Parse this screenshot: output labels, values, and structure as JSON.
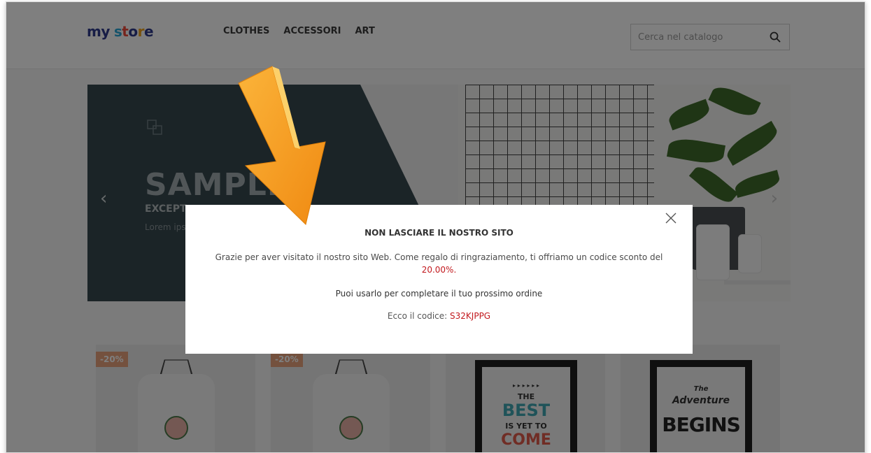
{
  "header": {
    "logo": {
      "letters": [
        "m",
        "y",
        " ",
        "s",
        "t",
        "o",
        "r",
        "e"
      ],
      "colors": [
        "#2e3a8c",
        "#2e3a8c",
        "#2e3a8c",
        "#2aa7d6",
        "#ef4a3a",
        "#2e3a8c",
        "#f2a51a",
        "#2e3a8c"
      ]
    },
    "nav": [
      "CLOTHES",
      "ACCESSORI",
      "ART"
    ],
    "search": {
      "placeholder": "Cerca nel catalogo",
      "icon": "search-icon"
    }
  },
  "carousel": {
    "title": "SAMPLE",
    "subtitle": "EXCEPT",
    "text": "Lorem ips adipiscin dignissim egestas s",
    "prev_icon": "chevron-left-icon",
    "next_icon": "chevron-right-icon"
  },
  "products": [
    {
      "badge": "-20%"
    },
    {
      "badge": "-20%"
    },
    {
      "poster_lines": [
        "▸ ▸ ▸ ▸ ▸ ▸",
        "THE",
        "BEST",
        "IS YET TO",
        "COME"
      ]
    },
    {
      "poster_lines": [
        "The",
        "Adventure",
        "BEGINS"
      ]
    }
  ],
  "modal": {
    "title": "NON LASCIARE IL NOSTRO SITO",
    "paragraph1_text": "Grazie per aver visitato il nostro sito Web. Come regalo di ringraziamento, ti offriamo un codice sconto del ",
    "paragraph1_highlight": "20.00%.",
    "paragraph2": "Puoi usarlo per completare il tuo prossimo ordine",
    "code_label": "Ecco il codice: ",
    "code": "S32KJPPG",
    "close_icon": "close-icon",
    "highlight_color": "#c2191e"
  },
  "pointer": {
    "icon": "arrow-pointer-icon",
    "color": "#f7a21b"
  }
}
